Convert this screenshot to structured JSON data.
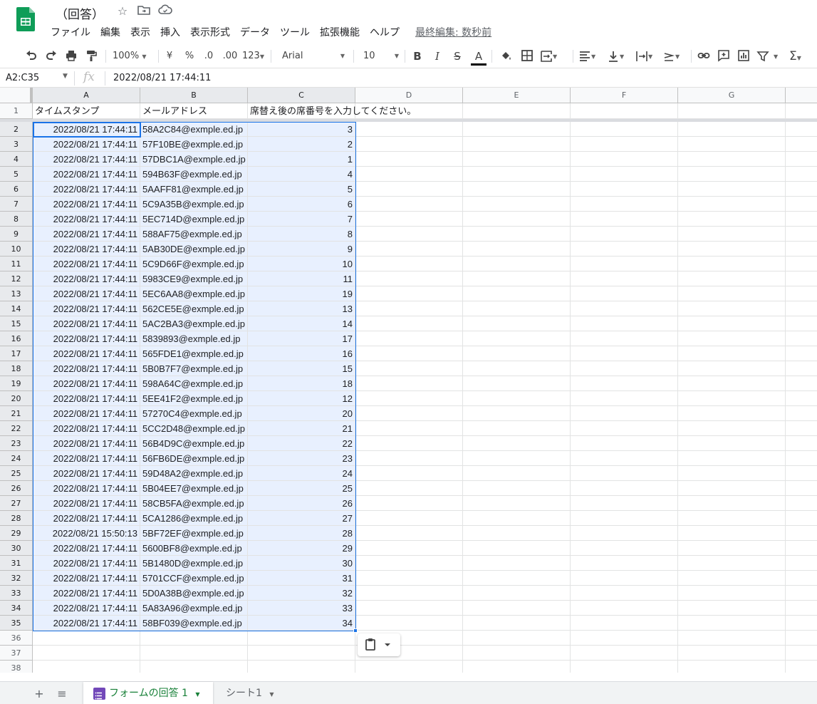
{
  "doc": {
    "title": "（回答）",
    "last_edit": "最終編集: 数秒前"
  },
  "menu": [
    "ファイル",
    "編集",
    "表示",
    "挿入",
    "表示形式",
    "データ",
    "ツール",
    "拡張機能",
    "ヘルプ"
  ],
  "toolbar": {
    "zoom": "100%",
    "currency": "¥",
    "percent": "%",
    "decrease_decimal": ".0",
    "increase_decimal": ".00",
    "more_formats": "123",
    "font": "Arial",
    "font_size": "10",
    "bold": "B",
    "italic": "I",
    "strike": "S",
    "text_color_glyph": "A",
    "text_color": "#000000",
    "sum_glyph": "Σ"
  },
  "formula_bar": {
    "name_box": "A2:C35",
    "fx": "fx",
    "content": "2022/08/21 17:44:11"
  },
  "sheet": {
    "columns": [
      "A",
      "B",
      "C",
      "D",
      "E",
      "F",
      "G"
    ],
    "header_row": [
      "タイムスタンプ",
      "メールアドレス",
      "席替え後の席番号を入力してください。"
    ],
    "rows": [
      [
        "2022/08/21 17:44:11",
        "58A2C84@exmple.ed.jp",
        "3"
      ],
      [
        "2022/08/21 17:44:11",
        "57F10BE@exmple.ed.jp",
        "2"
      ],
      [
        "2022/08/21 17:44:11",
        "57DBC1A@exmple.ed.jp",
        "1"
      ],
      [
        "2022/08/21 17:44:11",
        "594B63F@exmple.ed.jp",
        "4"
      ],
      [
        "2022/08/21 17:44:11",
        "5AAFF81@exmple.ed.jp",
        "5"
      ],
      [
        "2022/08/21 17:44:11",
        "5C9A35B@exmple.ed.jp",
        "6"
      ],
      [
        "2022/08/21 17:44:11",
        "5EC714D@exmple.ed.jp",
        "7"
      ],
      [
        "2022/08/21 17:44:11",
        "588AF75@exmple.ed.jp",
        "8"
      ],
      [
        "2022/08/21 17:44:11",
        "5AB30DE@exmple.ed.jp",
        "9"
      ],
      [
        "2022/08/21 17:44:11",
        "5C9D66F@exmple.ed.jp",
        "10"
      ],
      [
        "2022/08/21 17:44:11",
        "5983CE9@exmple.ed.jp",
        "11"
      ],
      [
        "2022/08/21 17:44:11",
        "5EC6AA8@exmple.ed.jp",
        "19"
      ],
      [
        "2022/08/21 17:44:11",
        "562CE5E@exmple.ed.jp",
        "13"
      ],
      [
        "2022/08/21 17:44:11",
        "5AC2BA3@exmple.ed.jp",
        "14"
      ],
      [
        "2022/08/21 17:44:11",
        "5839893@exmple.ed.jp",
        "17"
      ],
      [
        "2022/08/21 17:44:11",
        "565FDE1@exmple.ed.jp",
        "16"
      ],
      [
        "2022/08/21 17:44:11",
        "5B0B7F7@exmple.ed.jp",
        "15"
      ],
      [
        "2022/08/21 17:44:11",
        "598A64C@exmple.ed.jp",
        "18"
      ],
      [
        "2022/08/21 17:44:11",
        "5EE41F2@exmple.ed.jp",
        "12"
      ],
      [
        "2022/08/21 17:44:11",
        "57270C4@exmple.ed.jp",
        "20"
      ],
      [
        "2022/08/21 17:44:11",
        "5CC2D48@exmple.ed.jp",
        "21"
      ],
      [
        "2022/08/21 17:44:11",
        "56B4D9C@exmple.ed.jp",
        "22"
      ],
      [
        "2022/08/21 17:44:11",
        "56FB6DE@exmple.ed.jp",
        "23"
      ],
      [
        "2022/08/21 17:44:11",
        "59D48A2@exmple.ed.jp",
        "24"
      ],
      [
        "2022/08/21 17:44:11",
        "5B04EE7@exmple.ed.jp",
        "25"
      ],
      [
        "2022/08/21 17:44:11",
        "58CB5FA@exmple.ed.jp",
        "26"
      ],
      [
        "2022/08/21 17:44:11",
        "5CA1286@exmple.ed.jp",
        "27"
      ],
      [
        "2022/08/21 15:50:13",
        "5BF72EF@exmple.ed.jp",
        "28"
      ],
      [
        "2022/08/21 17:44:11",
        "5600BF8@exmple.ed.jp",
        "29"
      ],
      [
        "2022/08/21 17:44:11",
        "5B1480D@exmple.ed.jp",
        "30"
      ],
      [
        "2022/08/21 17:44:11",
        "5701CCF@exmple.ed.jp",
        "31"
      ],
      [
        "2022/08/21 17:44:11",
        "5D0A38B@exmple.ed.jp",
        "32"
      ],
      [
        "2022/08/21 17:44:11",
        "5A83A96@exmple.ed.jp",
        "33"
      ],
      [
        "2022/08/21 17:44:11",
        "58BF039@exmple.ed.jp",
        "34"
      ]
    ],
    "empty_rows": 3
  },
  "tabs": [
    {
      "label": "フォームの回答 1",
      "active": true
    },
    {
      "label": "シート1",
      "active": false
    }
  ],
  "colors": {
    "accent": "#1a73e8",
    "selection_fill": "#e8f0fe",
    "active_tab_text": "#188038",
    "form_icon": "#7248b9",
    "sheets_logo": "#0f9d58"
  }
}
